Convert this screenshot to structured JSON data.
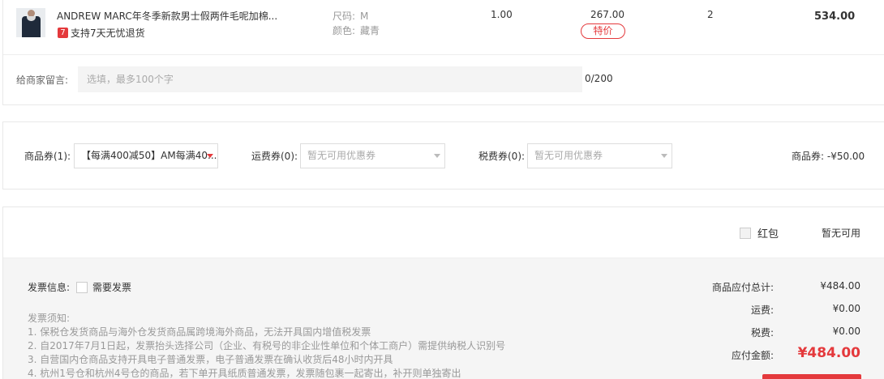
{
  "product": {
    "title": "ANDREW MARC年冬季新款男士假两件毛呢加棉...",
    "return_badge_num": "7",
    "return_policy": "支持7天无忧退货",
    "size_label": "尺码:",
    "size_value": "M",
    "color_label": "颜色:",
    "color_value": "藏青",
    "tax_rate": "1.00",
    "unit_price": "267.00",
    "price_tag": "特价",
    "quantity": "2",
    "subtotal": "534.00"
  },
  "message": {
    "label": "给商家留言:",
    "placeholder": "选填，最多100个字",
    "counter": "0/200"
  },
  "coupons": {
    "goods_label": "商品券(1):",
    "goods_selected": "【每满400减50】AM每满40...",
    "shipping_label": "运费券(0):",
    "shipping_placeholder": "暂无可用优惠券",
    "tax_label": "税费券(0):",
    "tax_placeholder": "暂无可用优惠券",
    "discount_summary": "商品券: -¥50.00"
  },
  "red_envelope": {
    "label": "红包",
    "status": "暂无可用"
  },
  "invoice": {
    "label": "发票信息:",
    "checkbox_label": "需要发票",
    "notes_title": "发票须知:",
    "notes": [
      "1. 保税仓发货商品与海外仓发货商品属跨境海外商品，无法开具国内增值税发票",
      "2. 自2017年7月1日起，发票抬头选择公司（企业、有税号的非企业性单位和个体工商户）需提供纳税人识别号",
      "3. 自营国内仓商品支持开具电子普通发票，电子普通发票在确认收货后48小时内开具",
      "4. 杭州1号仓和杭州4号仓的商品，若下单开具纸质普通发票，发票随包裹一起寄出，补开则单独寄出"
    ]
  },
  "summary": {
    "goods_total_label": "商品应付总计:",
    "goods_total": "¥484.00",
    "shipping_label": "运费:",
    "shipping": "¥0.00",
    "tax_label": "税费:",
    "tax": "¥0.00",
    "payable_label": "应付金额:",
    "payable": "¥484.00"
  },
  "colors": {
    "accent": "#e4393c",
    "panel_bg": "#f5f5f5",
    "border": "#e8e8e8"
  }
}
